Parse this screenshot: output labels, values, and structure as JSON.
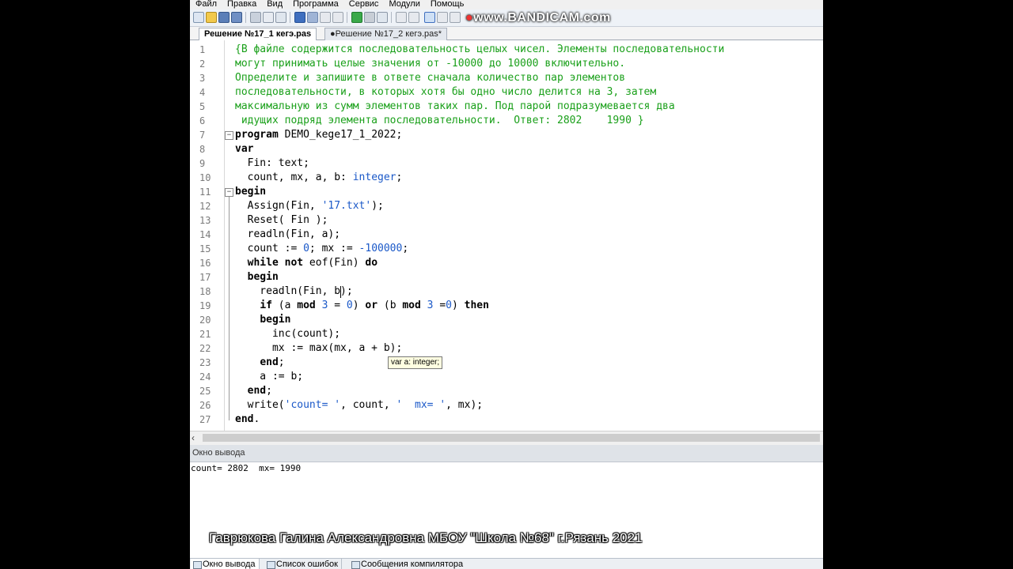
{
  "menu": [
    "Файл",
    "Правка",
    "Вид",
    "Программа",
    "Сервис",
    "Модули",
    "Помощь"
  ],
  "watermark": {
    "prefix": "www.",
    "brand": "BANDICAM",
    "suffix": ".com"
  },
  "tabs": [
    {
      "label": "Решение №17_1 кегэ.pas",
      "active": true
    },
    {
      "label": "●Решение №17_2 кегэ.pas*",
      "active": false
    }
  ],
  "code_lines": [
    [
      {
        "t": "{В файле содержится последовательность целых чисел. Элементы последовательности",
        "c": "cm"
      }
    ],
    [
      {
        "t": "могут принимать целые значения от -10000 до 10000 включительно.",
        "c": "cm"
      }
    ],
    [
      {
        "t": "Определите и запишите в ответе сначала количество пар элементов",
        "c": "cm"
      }
    ],
    [
      {
        "t": "последовательности, в которых хотя бы одно число делится на 3, затем",
        "c": "cm"
      }
    ],
    [
      {
        "t": "максимальную из сумм элементов таких пар. Под парой подразумевается два",
        "c": "cm"
      }
    ],
    [
      {
        "t": " идущих подряд элемента последовательности.  Ответ: 2802    1990 }",
        "c": "cm"
      }
    ],
    [
      {
        "t": "program",
        "c": "kw"
      },
      {
        "t": " DEMO_kege17_1_2022;",
        "c": ""
      }
    ],
    [
      {
        "t": "var",
        "c": "kw"
      }
    ],
    [
      {
        "t": "  Fin: text;",
        "c": ""
      }
    ],
    [
      {
        "t": "  count, mx, a, b: ",
        "c": ""
      },
      {
        "t": "integer",
        "c": "ty"
      },
      {
        "t": ";",
        "c": ""
      }
    ],
    [
      {
        "t": "begin",
        "c": "kw"
      }
    ],
    [
      {
        "t": "  Assign(Fin, ",
        "c": ""
      },
      {
        "t": "'17.txt'",
        "c": "st"
      },
      {
        "t": ");",
        "c": ""
      }
    ],
    [
      {
        "t": "  Reset( Fin );",
        "c": ""
      }
    ],
    [
      {
        "t": "  readln(Fin, a);",
        "c": ""
      }
    ],
    [
      {
        "t": "  count := ",
        "c": ""
      },
      {
        "t": "0",
        "c": "nm"
      },
      {
        "t": "; mx := ",
        "c": ""
      },
      {
        "t": "-100000",
        "c": "nm"
      },
      {
        "t": ";",
        "c": ""
      }
    ],
    [
      {
        "t": "  ",
        "c": ""
      },
      {
        "t": "while",
        "c": "kw"
      },
      {
        "t": " ",
        "c": ""
      },
      {
        "t": "not",
        "c": "kw"
      },
      {
        "t": " eof(Fin) ",
        "c": ""
      },
      {
        "t": "do",
        "c": "kw"
      }
    ],
    [
      {
        "t": "  ",
        "c": ""
      },
      {
        "t": "begin",
        "c": "kw"
      }
    ],
    [
      {
        "t": "    readln(Fin, b);",
        "c": ""
      }
    ],
    [
      {
        "t": "    ",
        "c": ""
      },
      {
        "t": "if",
        "c": "kw"
      },
      {
        "t": " (a ",
        "c": ""
      },
      {
        "t": "mod",
        "c": "kw"
      },
      {
        "t": " ",
        "c": ""
      },
      {
        "t": "3",
        "c": "nm"
      },
      {
        "t": " = ",
        "c": ""
      },
      {
        "t": "0",
        "c": "nm"
      },
      {
        "t": ") ",
        "c": ""
      },
      {
        "t": "or",
        "c": "kw"
      },
      {
        "t": " (b ",
        "c": ""
      },
      {
        "t": "mod",
        "c": "kw"
      },
      {
        "t": " ",
        "c": ""
      },
      {
        "t": "3",
        "c": "nm"
      },
      {
        "t": " =",
        "c": ""
      },
      {
        "t": "0",
        "c": "nm"
      },
      {
        "t": ") ",
        "c": ""
      },
      {
        "t": "then",
        "c": "kw"
      }
    ],
    [
      {
        "t": "    ",
        "c": ""
      },
      {
        "t": "begin",
        "c": "kw"
      }
    ],
    [
      {
        "t": "      inc(count);",
        "c": ""
      }
    ],
    [
      {
        "t": "      mx := max(mx, a + b);",
        "c": ""
      }
    ],
    [
      {
        "t": "    ",
        "c": ""
      },
      {
        "t": "end",
        "c": "kw"
      },
      {
        "t": ";",
        "c": ""
      }
    ],
    [
      {
        "t": "    a := b;",
        "c": ""
      }
    ],
    [
      {
        "t": "  ",
        "c": ""
      },
      {
        "t": "end",
        "c": "kw"
      },
      {
        "t": ";",
        "c": ""
      }
    ],
    [
      {
        "t": "  write(",
        "c": ""
      },
      {
        "t": "'count= '",
        "c": "st"
      },
      {
        "t": ", count, ",
        "c": ""
      },
      {
        "t": "'  mx= '",
        "c": "st"
      },
      {
        "t": ", mx);",
        "c": ""
      }
    ],
    [
      {
        "t": "end",
        "c": "kw"
      },
      {
        "t": ".",
        "c": ""
      }
    ]
  ],
  "tooltip": "var a: integer;",
  "output": {
    "header": "Окно вывода",
    "text": "count= 2802  mx= 1990"
  },
  "caption": "Гаврюкова Галина Александровна МБОУ \"Школа №68\" г.Рязань 2021",
  "bottom_tabs": [
    "Окно вывода",
    "Список ошибок",
    "Сообщения компилятора"
  ]
}
